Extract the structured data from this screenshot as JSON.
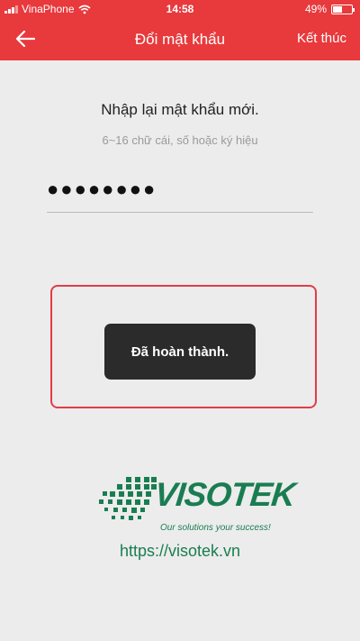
{
  "status_bar": {
    "carrier": "VinaPhone",
    "time": "14:58",
    "battery_percent": "49%",
    "battery_level": 0.49
  },
  "nav": {
    "title": "Đổi mật khẩu",
    "done_label": "Kết thúc",
    "back_icon": "arrow-left-icon"
  },
  "form": {
    "title": "Nhập lại mật khẩu mới.",
    "hint": "6~16 chữ cái, số hoặc ký hiệu",
    "password_masked": "●●●●●●●●"
  },
  "toast": {
    "message": "Đã hoàn thành."
  },
  "watermark": {
    "brand": "VISOTEK",
    "tagline": "Our solutions your success!",
    "url": "https://visotek.vn"
  },
  "colors": {
    "header": "#e8393c",
    "background": "#ececec",
    "highlight_border": "#e23c47",
    "toast": "#2b2b2b",
    "brand_green": "#1a7d52"
  }
}
